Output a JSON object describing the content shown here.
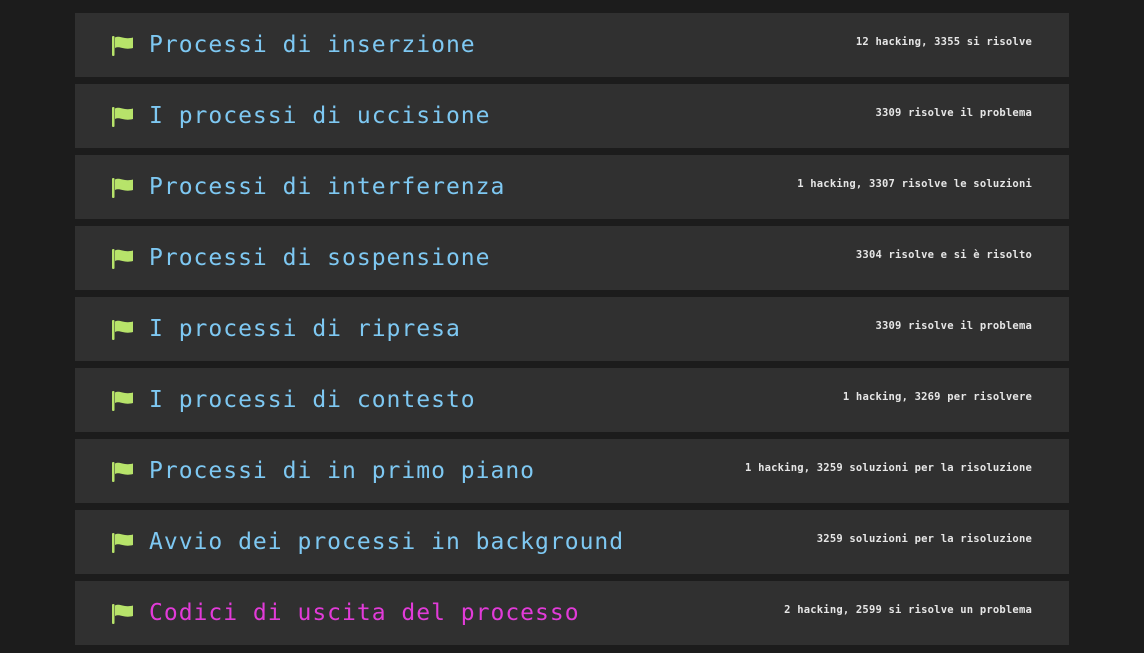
{
  "colors": {
    "background": "#1c1c1c",
    "row_background": "#303030",
    "title_default": "#7ec8f2",
    "title_active": "#e23bd9",
    "flag": "#b7e36a",
    "stats_text": "#e6e6e6"
  },
  "levels": [
    {
      "title": "Processi di inserzione",
      "stats": "12 hacking, 3355 si risolve",
      "state": "default",
      "icon": "flag-icon"
    },
    {
      "title": "I processi di uccisione",
      "stats": "3309 risolve il problema",
      "state": "default",
      "icon": "flag-icon"
    },
    {
      "title": "Processi di interferenza",
      "stats": "1 hacking, 3307 risolve le soluzioni",
      "state": "default",
      "icon": "flag-icon"
    },
    {
      "title": "Processi di sospensione",
      "stats": "3304 risolve e si è risolto",
      "state": "default",
      "icon": "flag-icon"
    },
    {
      "title": "I processi di ripresa",
      "stats": "3309 risolve il problema",
      "state": "default",
      "icon": "flag-icon"
    },
    {
      "title": "I processi di contesto",
      "stats": "1 hacking, 3269 per risolvere",
      "state": "default",
      "icon": "flag-icon"
    },
    {
      "title": "Processi di in primo piano",
      "stats": "1 hacking, 3259 soluzioni per la risoluzione",
      "state": "default",
      "icon": "flag-icon"
    },
    {
      "title": "Avvio dei processi in background",
      "stats": "3259 soluzioni per la risoluzione",
      "state": "default",
      "icon": "flag-icon"
    },
    {
      "title": "Codici di uscita del processo",
      "stats": "2 hacking, 2599 si risolve un problema",
      "state": "active",
      "icon": "flag-icon"
    }
  ]
}
